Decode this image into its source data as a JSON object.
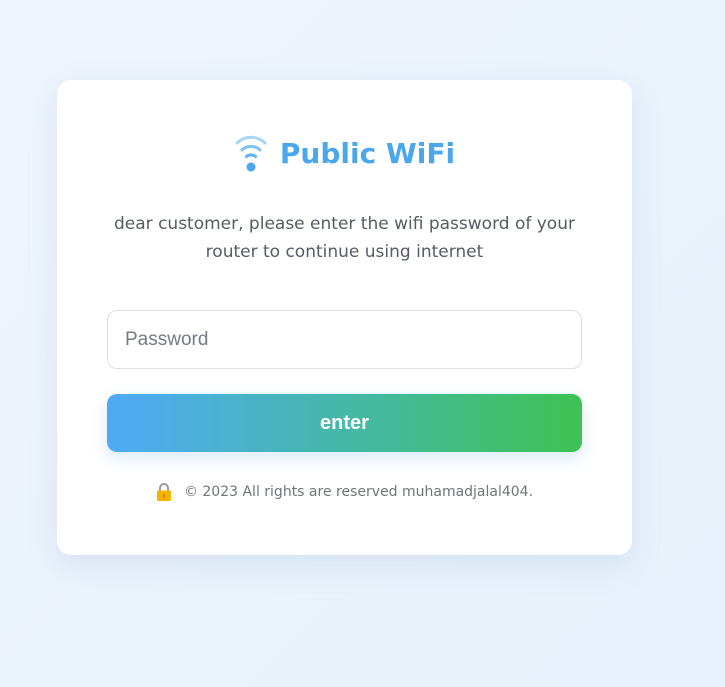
{
  "brand": {
    "title": "Public WiFi",
    "icon": "wifi-icon",
    "color": "#4aa7ec"
  },
  "message": "dear customer, please enter the wifi password of your router to continue using internet",
  "form": {
    "password_placeholder": "Password",
    "password_value": "",
    "submit_label": "enter",
    "button_gradient": [
      "#4eaaf6",
      "#3ec253"
    ]
  },
  "footer": {
    "icon": "lock-icon",
    "text": "© 2023 All rights are reserved muhamadjalal404."
  }
}
